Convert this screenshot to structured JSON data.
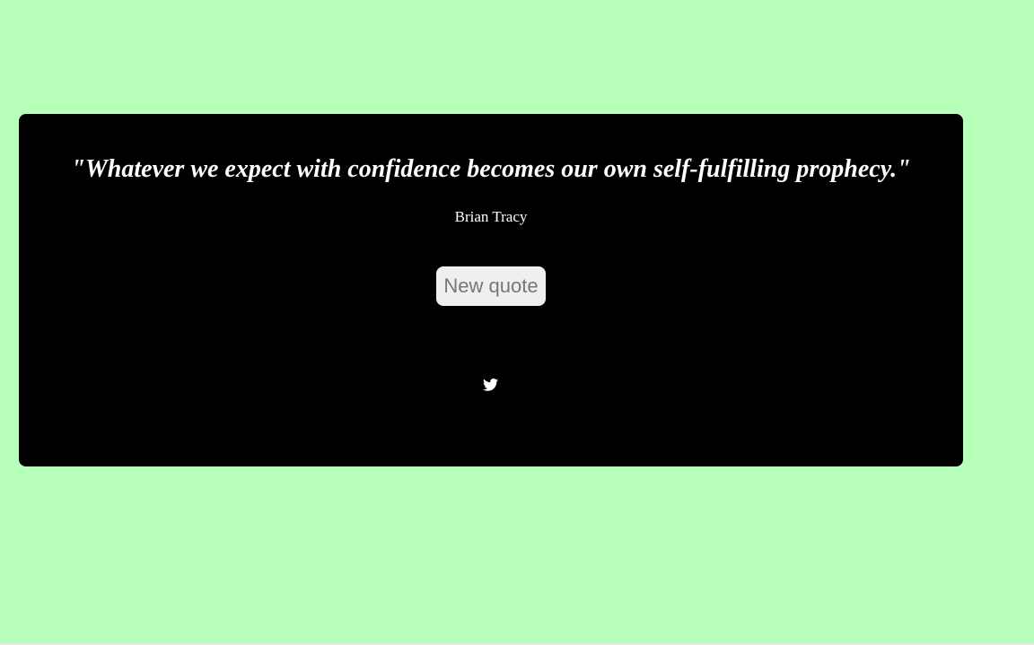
{
  "page": {
    "background_color": "#b8ffba"
  },
  "quote_box": {
    "background_color": "#000000",
    "text": "\"Whatever we expect with confidence becomes our own self-fulfilling prophecy.\"",
    "author": "Brian Tracy",
    "new_quote_label": "New quote",
    "tweet_icon": "twitter-icon"
  }
}
